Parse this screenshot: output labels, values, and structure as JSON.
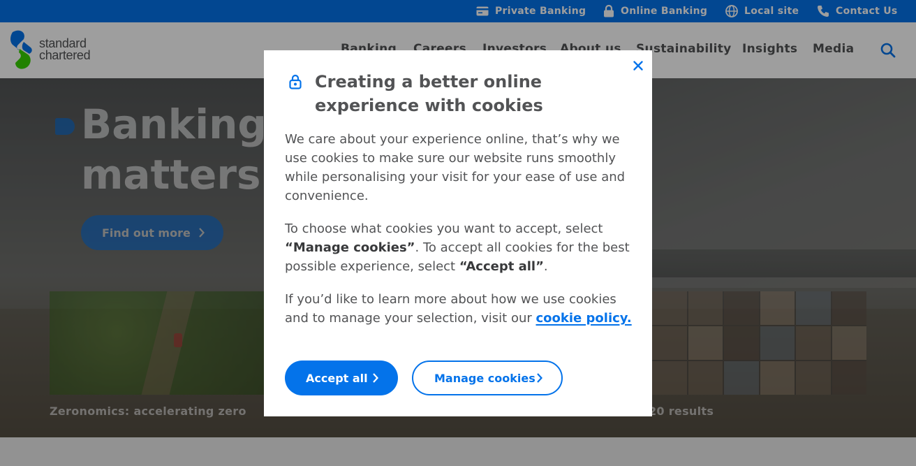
{
  "colors": {
    "brand_blue": "#0473ea",
    "brand_green": "#38d200",
    "text_grey": "#525355",
    "white": "#ffffff"
  },
  "utility_bar": {
    "items": [
      {
        "label": "Private Banking",
        "icon": "card-icon"
      },
      {
        "label": "Online Banking",
        "icon": "lock-icon"
      },
      {
        "label": "Local site",
        "icon": "globe-icon"
      },
      {
        "label": "Contact Us",
        "icon": "phone-icon"
      }
    ]
  },
  "header": {
    "logo_line1": "standard",
    "logo_line2": "chartered",
    "nav": [
      "Banking",
      "Careers",
      "Investors",
      "About us",
      "Sustainability",
      "Insights",
      "Media"
    ],
    "search_icon": "search-icon"
  },
  "hero": {
    "title_line1": "Banking w",
    "title_line2": "matters m",
    "cta_label": "Find out more",
    "cards": [
      {
        "caption": "Zeronomics: accelerating zero"
      },
      {
        "caption": "20 results"
      }
    ]
  },
  "cookie_modal": {
    "title": "Creating a better online experience with cookies",
    "para1": "We care about your experience online, that’s why we use cookies to make sure our website runs smoothly while personalising your visit for your ease of use and convenience.",
    "para2_a": "To choose what cookies you want to accept, select ",
    "para2_b": "“Manage cookies”",
    "para2_c": ". To accept all cookies for the best possible experience, select ",
    "para2_d": "“Accept all”",
    "para2_e": ".",
    "para3_a": "If you’d like to learn more about how we use cookies and to manage your selection, visit our ",
    "para3_link": "cookie policy.",
    "accept_label": "Accept all",
    "manage_label": "Manage cookies"
  }
}
